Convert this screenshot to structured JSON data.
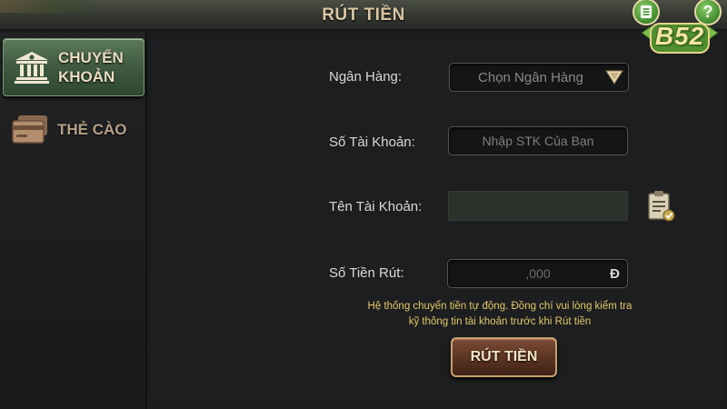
{
  "title": "RÚT TIỀN",
  "top_buttons": {
    "menu_icon": "list-icon",
    "help_label": "?"
  },
  "logo": {
    "text": "B52"
  },
  "sidebar": {
    "items": [
      {
        "label": "CHUYỂN\nKHOẢN",
        "icon": "bank-icon",
        "active": true
      },
      {
        "label": "THẺ CÀO",
        "icon": "card-icon",
        "active": false
      }
    ]
  },
  "form": {
    "bank": {
      "label": "Ngân Hàng:",
      "value": "Chọn Ngân Hàng"
    },
    "account_number": {
      "label": "Số Tài Khoản:",
      "placeholder": "Nhập STK Của Bạn"
    },
    "account_name": {
      "label": "Tên Tài Khoản:",
      "value": "",
      "icon": "clipboard-check-icon"
    },
    "amount": {
      "label": "Số Tiền Rút:",
      "placeholder": ",000",
      "currency": "Đ"
    }
  },
  "notice": {
    "line1": "Hệ thống chuyển tiền tự động. Đồng chí vui lòng kiểm tra",
    "line2": "kỹ thông tin tài khoản trước khi Rút tiền"
  },
  "submit_label": "RÚT TIỀN",
  "colors": {
    "accent_green": "#3e5a40",
    "notice_yellow": "#e3c96a",
    "button_brown": "#5a3322"
  }
}
